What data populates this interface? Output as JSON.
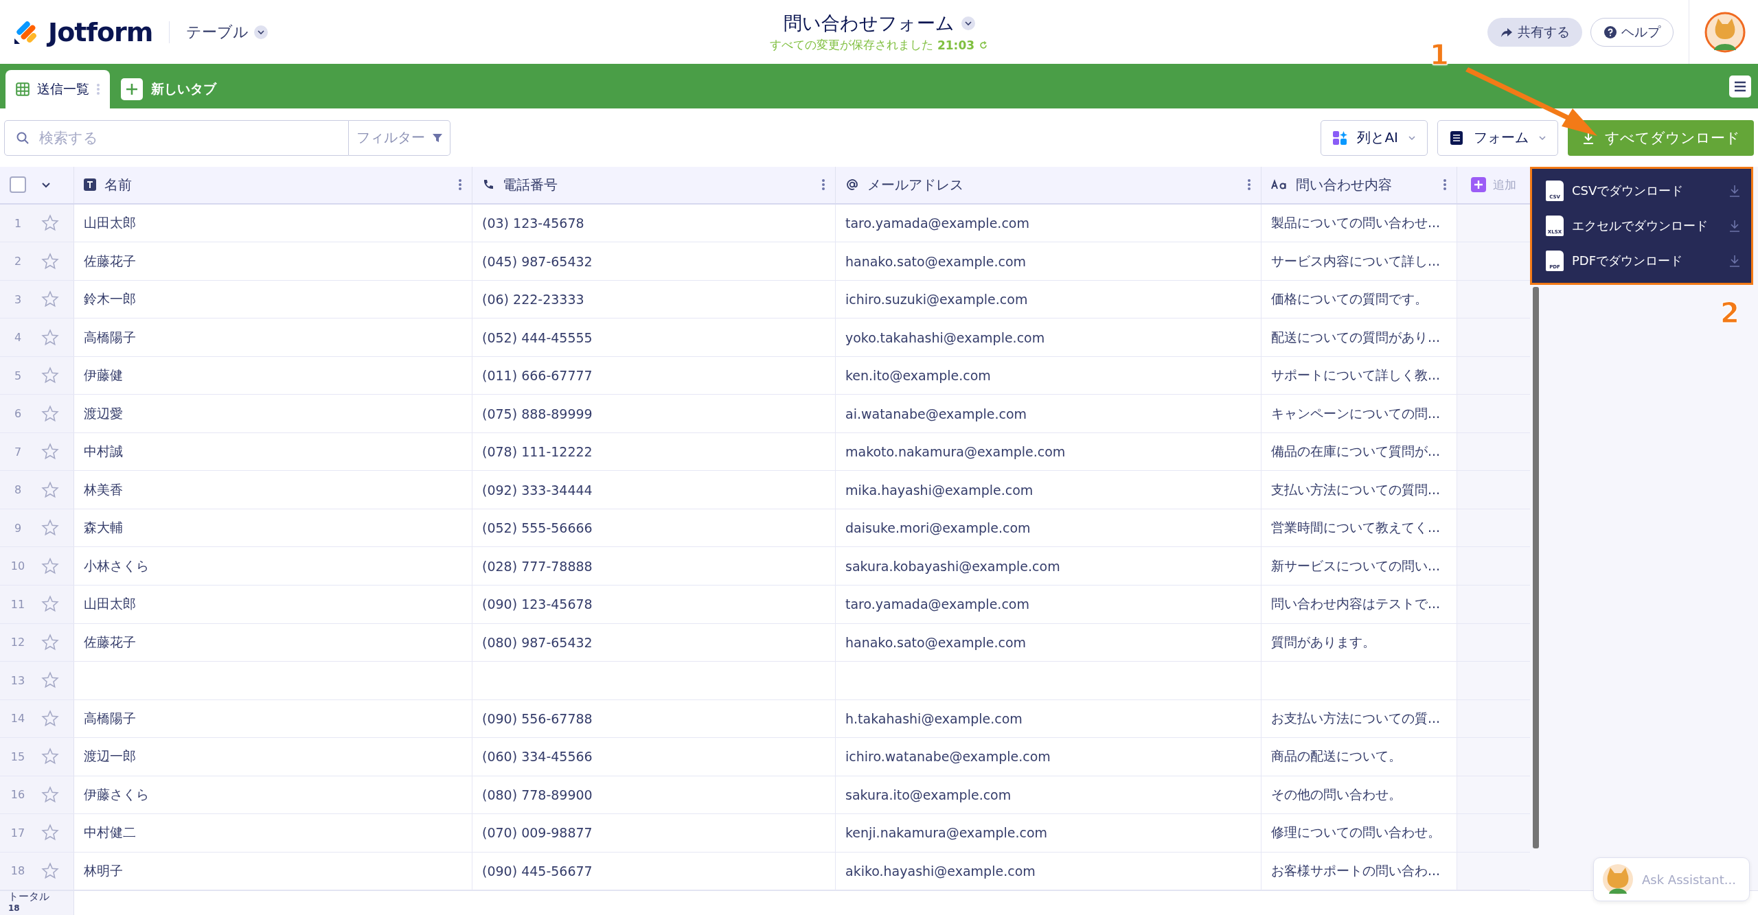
{
  "header": {
    "logo_text": "Jotform",
    "view_switcher": "テーブル",
    "form_title": "問い合わせフォーム",
    "save_status": "すべての変更が保存されました",
    "save_time": "21:03",
    "share_button": "共有する",
    "help_button": "ヘルプ"
  },
  "tabs": [
    {
      "label": "送信一覧",
      "selected": true
    }
  ],
  "new_tab": "新しいタブ",
  "toolbar": {
    "search": {
      "placeholder": "検索する"
    },
    "filter": "フィルター",
    "columns_ai": "列とAI",
    "form": "フォーム",
    "download_all": "すべてダウンロード"
  },
  "table": {
    "select_all": {
      "checked": false
    },
    "columns": [
      {
        "label": "名前",
        "kind": "text"
      },
      {
        "label": "電話番号",
        "kind": "phone"
      },
      {
        "label": "メールアドレス",
        "kind": "email"
      },
      {
        "label": "問い合わせ内容",
        "kind": "textarea"
      }
    ],
    "add_column": "追加",
    "rows": [
      {
        "num": "1",
        "starred": false,
        "cells": [
          "山田太郎",
          "(03) 123-45678",
          "taro.yamada@example.com",
          "製品についての問い合わせ..."
        ]
      },
      {
        "num": "2",
        "starred": false,
        "cells": [
          "佐藤花子",
          "(045) 987-65432",
          "hanako.sato@example.com",
          "サービス内容について詳し..."
        ]
      },
      {
        "num": "3",
        "starred": false,
        "cells": [
          "鈴木一郎",
          "(06) 222-23333",
          "ichiro.suzuki@example.com",
          "価格についての質問です。"
        ]
      },
      {
        "num": "4",
        "starred": false,
        "cells": [
          "高橋陽子",
          "(052) 444-45555",
          "yoko.takahashi@example.com",
          "配送についての質問があり..."
        ]
      },
      {
        "num": "5",
        "starred": false,
        "cells": [
          "伊藤健",
          "(011) 666-67777",
          "ken.ito@example.com",
          "サポートについて詳しく教..."
        ]
      },
      {
        "num": "6",
        "starred": false,
        "cells": [
          "渡辺愛",
          "(075) 888-89999",
          "ai.watanabe@example.com",
          "キャンペーンについての問..."
        ]
      },
      {
        "num": "7",
        "starred": false,
        "cells": [
          "中村誠",
          "(078) 111-12222",
          "makoto.nakamura@example.com",
          "備品の在庫について質問が..."
        ]
      },
      {
        "num": "8",
        "starred": false,
        "cells": [
          "林美香",
          "(092) 333-34444",
          "mika.hayashi@example.com",
          "支払い方法についての質問..."
        ]
      },
      {
        "num": "9",
        "starred": false,
        "cells": [
          "森大輔",
          "(052) 555-56666",
          "daisuke.mori@example.com",
          "営業時間について教えてく..."
        ]
      },
      {
        "num": "10",
        "starred": false,
        "cells": [
          "小林さくら",
          "(028) 777-78888",
          "sakura.kobayashi@example.com",
          "新サービスについての問い..."
        ]
      },
      {
        "num": "11",
        "starred": false,
        "cells": [
          "山田太郎",
          "(090) 123-45678",
          "taro.yamada@example.com",
          "問い合わせ内容はテストで..."
        ]
      },
      {
        "num": "12",
        "starred": false,
        "cells": [
          "佐藤花子",
          "(080) 987-65432",
          "hanako.sato@example.com",
          "質問があります。"
        ]
      },
      {
        "num": "13",
        "starred": false
      },
      {
        "num": "14",
        "starred": false,
        "cells": [
          "高橋陽子",
          "(090) 556-67788",
          "h.takahashi@example.com",
          "お支払い方法についての質..."
        ]
      },
      {
        "num": "15",
        "starred": false,
        "cells": [
          "渡辺一郎",
          "(060) 334-45566",
          "ichiro.watanabe@example.com",
          "商品の配送について。"
        ]
      },
      {
        "num": "16",
        "starred": false,
        "cells": [
          "伊藤さくら",
          "(080) 778-89900",
          "sakura.ito@example.com",
          "その他の問い合わせ。"
        ]
      },
      {
        "num": "17",
        "starred": false,
        "cells": [
          "中村健二",
          "(070) 009-98877",
          "kenji.nakamura@example.com",
          "修理についての問い合わせ。"
        ]
      },
      {
        "num": "18",
        "starred": false,
        "cells": [
          "林明子",
          "(090) 445-56677",
          "akiko.hayashi@example.com",
          "お客様サポートの問い合わ..."
        ]
      }
    ]
  },
  "footer": {
    "total_label": "トータル",
    "total": "18"
  },
  "download_menu": [
    {
      "label": "CSVでダウンロード",
      "badge": "CSV"
    },
    {
      "label": "エクセルでダウンロード",
      "badge": "XLSX"
    },
    {
      "label": "PDFでダウンロード",
      "badge": "PDF"
    }
  ],
  "assistant_button": "Ask Assistant...",
  "annotations": [
    "1",
    "2"
  ]
}
